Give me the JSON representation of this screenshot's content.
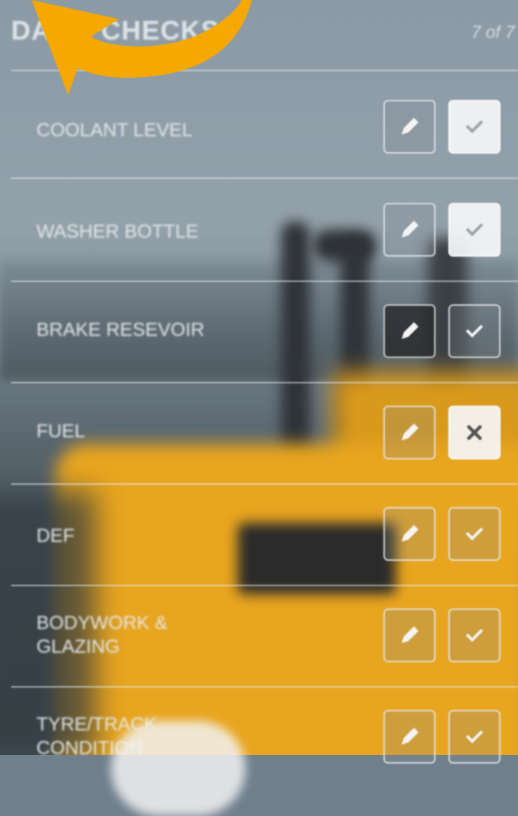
{
  "header": {
    "title": "DAILY CHECKS",
    "counter": "7 of 7"
  },
  "rows": [
    {
      "label": "COOLANT LEVEL",
      "status": "ok"
    },
    {
      "label": "WASHER BOTTLE",
      "status": "ok"
    },
    {
      "label": "BRAKE RESEVOIR",
      "status": "ok"
    },
    {
      "label": "FUEL",
      "status": "fail"
    },
    {
      "label": "DEF",
      "status": "unset"
    },
    {
      "label": "BODYWORK & GLAZING",
      "status": "unset"
    },
    {
      "label": "TYRE/TRACK CONDITION",
      "status": "unset"
    }
  ],
  "icons": {
    "edit": "pencil-icon",
    "pass": "check-icon",
    "fail": "cross-icon"
  },
  "colors": {
    "arrow": "#f5a800",
    "machine": "#e8a51f",
    "check_light": "#9aa4aa",
    "white_line": "#e3e8ea"
  }
}
